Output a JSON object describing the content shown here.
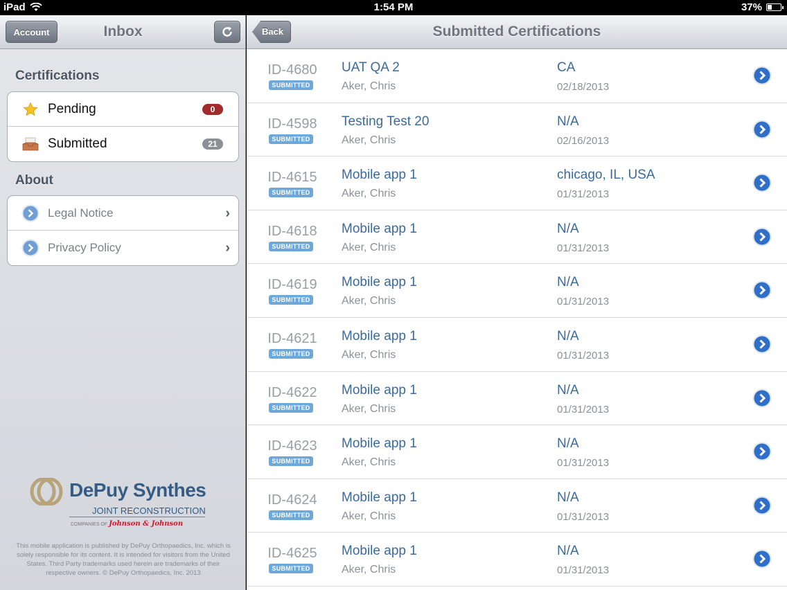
{
  "status_bar": {
    "carrier": "iPad",
    "time": "1:54 PM",
    "battery": "37%",
    "battery_level": 0.37
  },
  "sidebar": {
    "title": "Inbox",
    "account_label": "Account",
    "refresh_icon": "refresh-icon",
    "certifications_title": "Certifications",
    "cert_items": [
      {
        "label": "Pending",
        "count": "0",
        "icon": "star-icon",
        "count_color": "#a32a2a"
      },
      {
        "label": "Submitted",
        "count": "21",
        "icon": "inbox-tray-icon",
        "count_color": "#8c9096"
      }
    ],
    "about_title": "About",
    "about_items": [
      {
        "label": "Legal Notice",
        "icon": "disclosure-icon"
      },
      {
        "label": "Privacy Policy",
        "icon": "disclosure-icon"
      }
    ],
    "logo": {
      "brand": "DePuy Synthes",
      "subtitle": "JOINT RECONSTRUCTION",
      "companies": "COMPANIES OF",
      "jj": "Johnson & Johnson"
    },
    "disclaimer": "This mobile application is published by DePuy Orthopaedics, Inc. which is solely responsible for its content. It is intended for visitors from the United States. Third Party trademarks used herein are trademarks of their respective owners. © DePuy Orthopaedics, Inc. 2013"
  },
  "main": {
    "title": "Submitted Certifications",
    "back_label": "Back",
    "badge_label": "SUBMITTED",
    "rows": [
      {
        "id": "ID-4680",
        "title": "UAT QA 2",
        "person": "Aker, Chris",
        "location": "CA",
        "date": "02/18/2013"
      },
      {
        "id": "ID-4598",
        "title": "Testing Test 20",
        "person": "Aker, Chris",
        "location": "N/A",
        "date": "02/16/2013"
      },
      {
        "id": "ID-4615",
        "title": "Mobile app 1",
        "person": "Aker, Chris",
        "location": "chicago, IL, USA",
        "date": "01/31/2013"
      },
      {
        "id": "ID-4618",
        "title": "Mobile app 1",
        "person": "Aker, Chris",
        "location": "N/A",
        "date": "01/31/2013"
      },
      {
        "id": "ID-4619",
        "title": "Mobile app 1",
        "person": "Aker, Chris",
        "location": "N/A",
        "date": "01/31/2013"
      },
      {
        "id": "ID-4621",
        "title": "Mobile app 1",
        "person": "Aker, Chris",
        "location": "N/A",
        "date": "01/31/2013"
      },
      {
        "id": "ID-4622",
        "title": "Mobile app 1",
        "person": "Aker, Chris",
        "location": "N/A",
        "date": "01/31/2013"
      },
      {
        "id": "ID-4623",
        "title": "Mobile app 1",
        "person": "Aker, Chris",
        "location": "N/A",
        "date": "01/31/2013"
      },
      {
        "id": "ID-4624",
        "title": "Mobile app 1",
        "person": "Aker, Chris",
        "location": "N/A",
        "date": "01/31/2013"
      },
      {
        "id": "ID-4625",
        "title": "Mobile app 1",
        "person": "Aker, Chris",
        "location": "N/A",
        "date": "01/31/2013"
      }
    ]
  }
}
